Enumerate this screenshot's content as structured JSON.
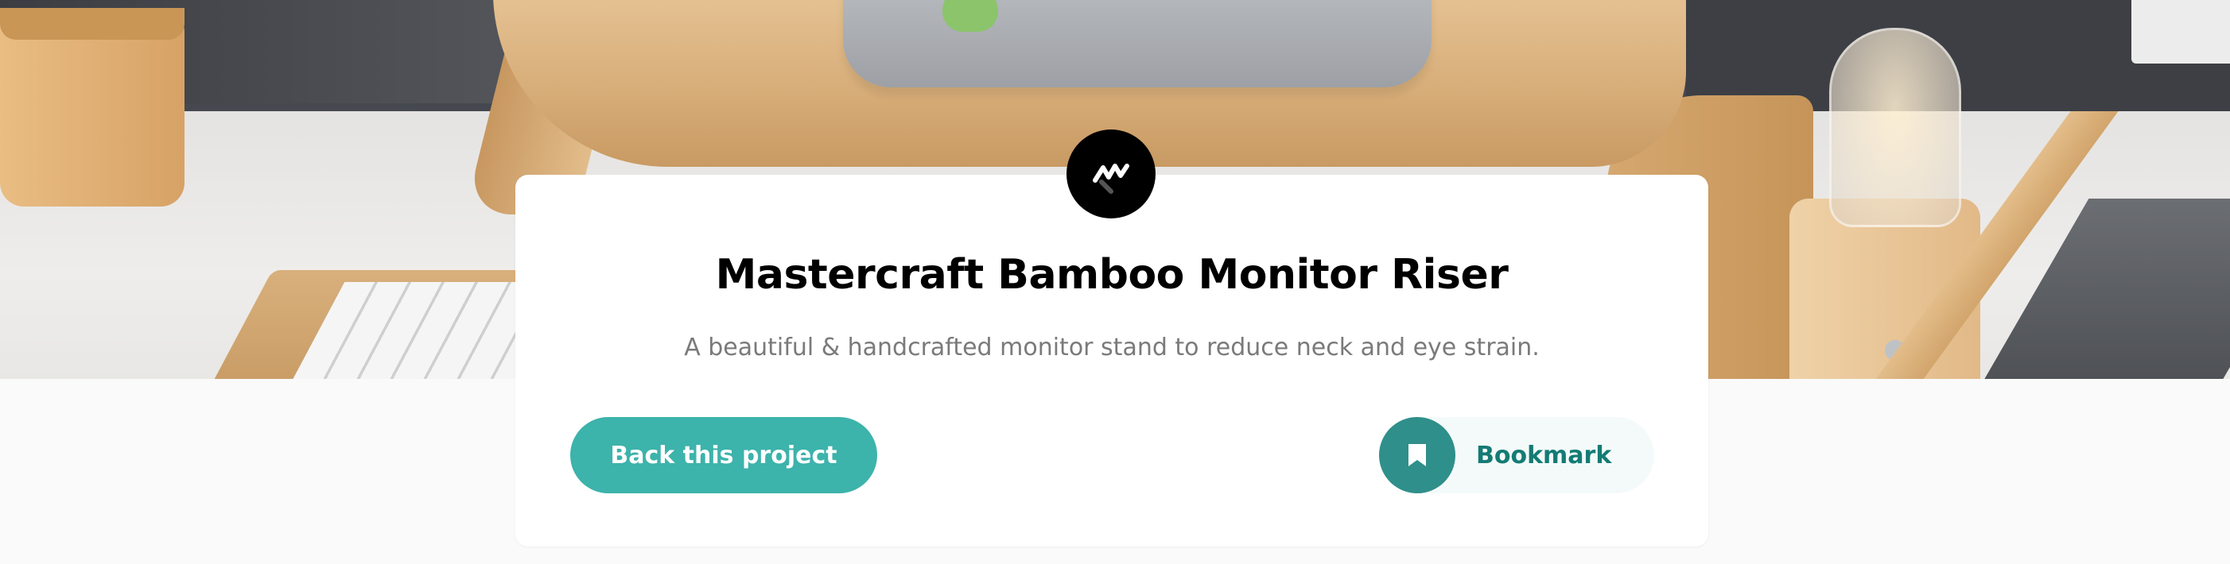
{
  "project": {
    "title": "Mastercraft Bamboo Monitor Riser",
    "description": "A beautiful & handcrafted monitor stand to reduce neck and eye strain.",
    "logo_icon": "mastercraft-logo-icon"
  },
  "actions": {
    "back_label": "Back this project",
    "bookmark_label": "Bookmark",
    "bookmark_icon": "bookmark-icon"
  },
  "colors": {
    "primary": "#3cb3ab",
    "primary_dark": "#147b74",
    "bookmark_circle": "#2f8f8a",
    "background": "#fafafa",
    "card": "#ffffff"
  }
}
